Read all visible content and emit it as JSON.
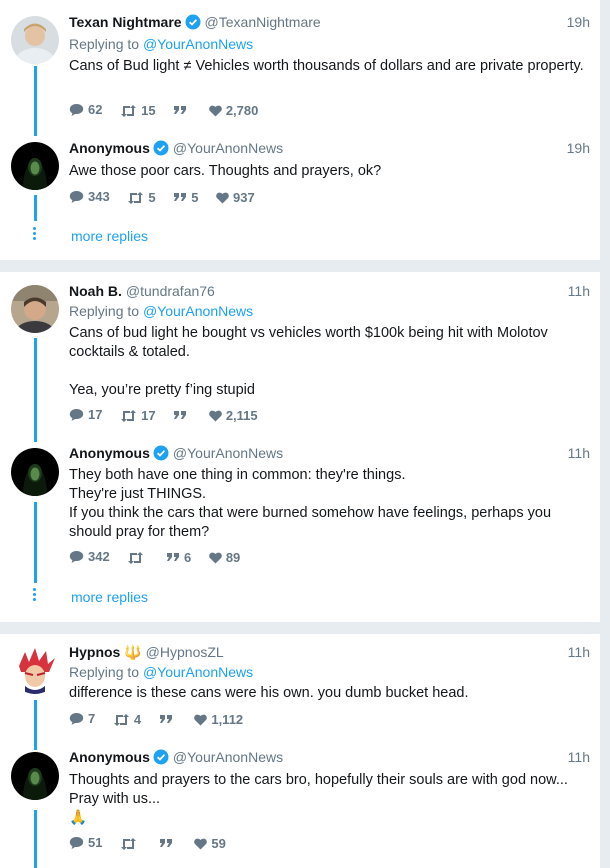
{
  "colors": {
    "accent": "#1da1f2",
    "muted": "#657786",
    "text": "#14171a",
    "background": "#e6ecf0"
  },
  "threads": [
    {
      "reply": {
        "name": "Texan Nightmare",
        "verified": true,
        "handle": "@TexanNightmare",
        "time": "19h",
        "replying_prefix": "Replying to",
        "replying_to": "@YourAnonNews",
        "text": "Cans of Bud light ≠ Vehicles worth thousands of dollars and are private property.",
        "replies": "62",
        "retweets": "15",
        "quotes": "",
        "likes": "2,780"
      },
      "response": {
        "name": "Anonymous",
        "verified": true,
        "handle": "@YourAnonNews",
        "time": "19h",
        "text": "Awe those poor cars.  Thoughts and prayers, ok?",
        "replies": "343",
        "retweets": "5",
        "quotes": "5",
        "likes": "937"
      },
      "more_replies": "more replies"
    },
    {
      "reply": {
        "name": "Noah B.",
        "verified": false,
        "handle": "@tundrafan76",
        "time": "11h",
        "replying_prefix": "Replying to",
        "replying_to": "@YourAnonNews",
        "text_lines": [
          "Cans of bud light he bought vs vehicles worth $100k being hit with Molotov cocktails & totaled.",
          "Yea, you’re pretty f’ing stupid"
        ],
        "replies": "17",
        "retweets": "17",
        "quotes": "",
        "likes": "2,115"
      },
      "response": {
        "name": "Anonymous",
        "verified": true,
        "handle": "@YourAnonNews",
        "time": "11h",
        "text_lines": [
          "They both have one thing in common: they're things.",
          "They're just THINGS.",
          "If you think the cars that were burned somehow have feelings, perhaps you should pray for them?"
        ],
        "replies": "342",
        "retweets": "",
        "quotes": "6",
        "likes": "89"
      },
      "more_replies": "more replies"
    },
    {
      "reply": {
        "name": "Hypnos",
        "badge": "🔱",
        "verified": false,
        "handle": "@HypnosZL",
        "time": "11h",
        "replying_prefix": "Replying to",
        "replying_to": "@YourAnonNews",
        "text": "difference is these cans were his own. you dumb bucket head.",
        "replies": "7",
        "retweets": "4",
        "quotes": "",
        "likes": "1,112"
      },
      "response": {
        "name": "Anonymous",
        "verified": true,
        "handle": "@YourAnonNews",
        "time": "11h",
        "text_lines": [
          "Thoughts and prayers to the cars bro, hopefully their souls are with god now... Pray with us...",
          "🙏"
        ],
        "replies": "51",
        "retweets": "",
        "quotes": "",
        "likes": "59"
      }
    }
  ]
}
